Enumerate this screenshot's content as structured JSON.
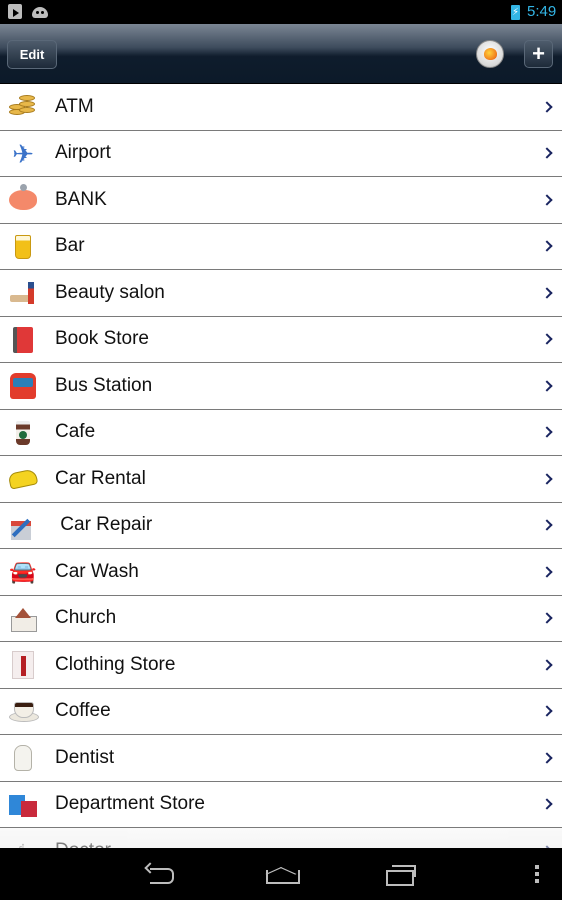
{
  "status_bar": {
    "left_icons": [
      "play-store-icon",
      "android-icon"
    ],
    "battery": "charging",
    "time": "5:49",
    "accent_color": "#33b5e5"
  },
  "action_bar": {
    "edit_label": "Edit",
    "logo_icon": "app-logo-icon",
    "add_label": "+"
  },
  "list": {
    "items": [
      {
        "label": "ATM",
        "icon": "coins-icon"
      },
      {
        "label": "Airport",
        "icon": "airplane-icon"
      },
      {
        "label": "BANK",
        "icon": "piggy-bank-icon"
      },
      {
        "label": "Bar",
        "icon": "beer-icon"
      },
      {
        "label": "Beauty salon",
        "icon": "beauty-salon-icon"
      },
      {
        "label": "Book Store",
        "icon": "book-icon"
      },
      {
        "label": "Bus Station",
        "icon": "bus-icon"
      },
      {
        "label": "Cafe",
        "icon": "coffee-cup-icon"
      },
      {
        "label": "Car Rental",
        "icon": "taxi-icon"
      },
      {
        "label": " Car Repair",
        "icon": "car-repair-icon"
      },
      {
        "label": "Car Wash",
        "icon": "car-wash-icon"
      },
      {
        "label": "Church",
        "icon": "church-icon"
      },
      {
        "label": "Clothing Store",
        "icon": "shirt-icon"
      },
      {
        "label": "Coffee",
        "icon": "coffee-icon"
      },
      {
        "label": "Dentist",
        "icon": "tooth-icon"
      },
      {
        "label": "Department Store",
        "icon": "shopping-bags-icon"
      },
      {
        "label": "Doctor",
        "icon": "stethoscope-icon"
      }
    ],
    "chevron_color": "#1a2560"
  },
  "nav_bar": {
    "buttons": [
      "back",
      "home",
      "recent-apps",
      "menu"
    ]
  }
}
